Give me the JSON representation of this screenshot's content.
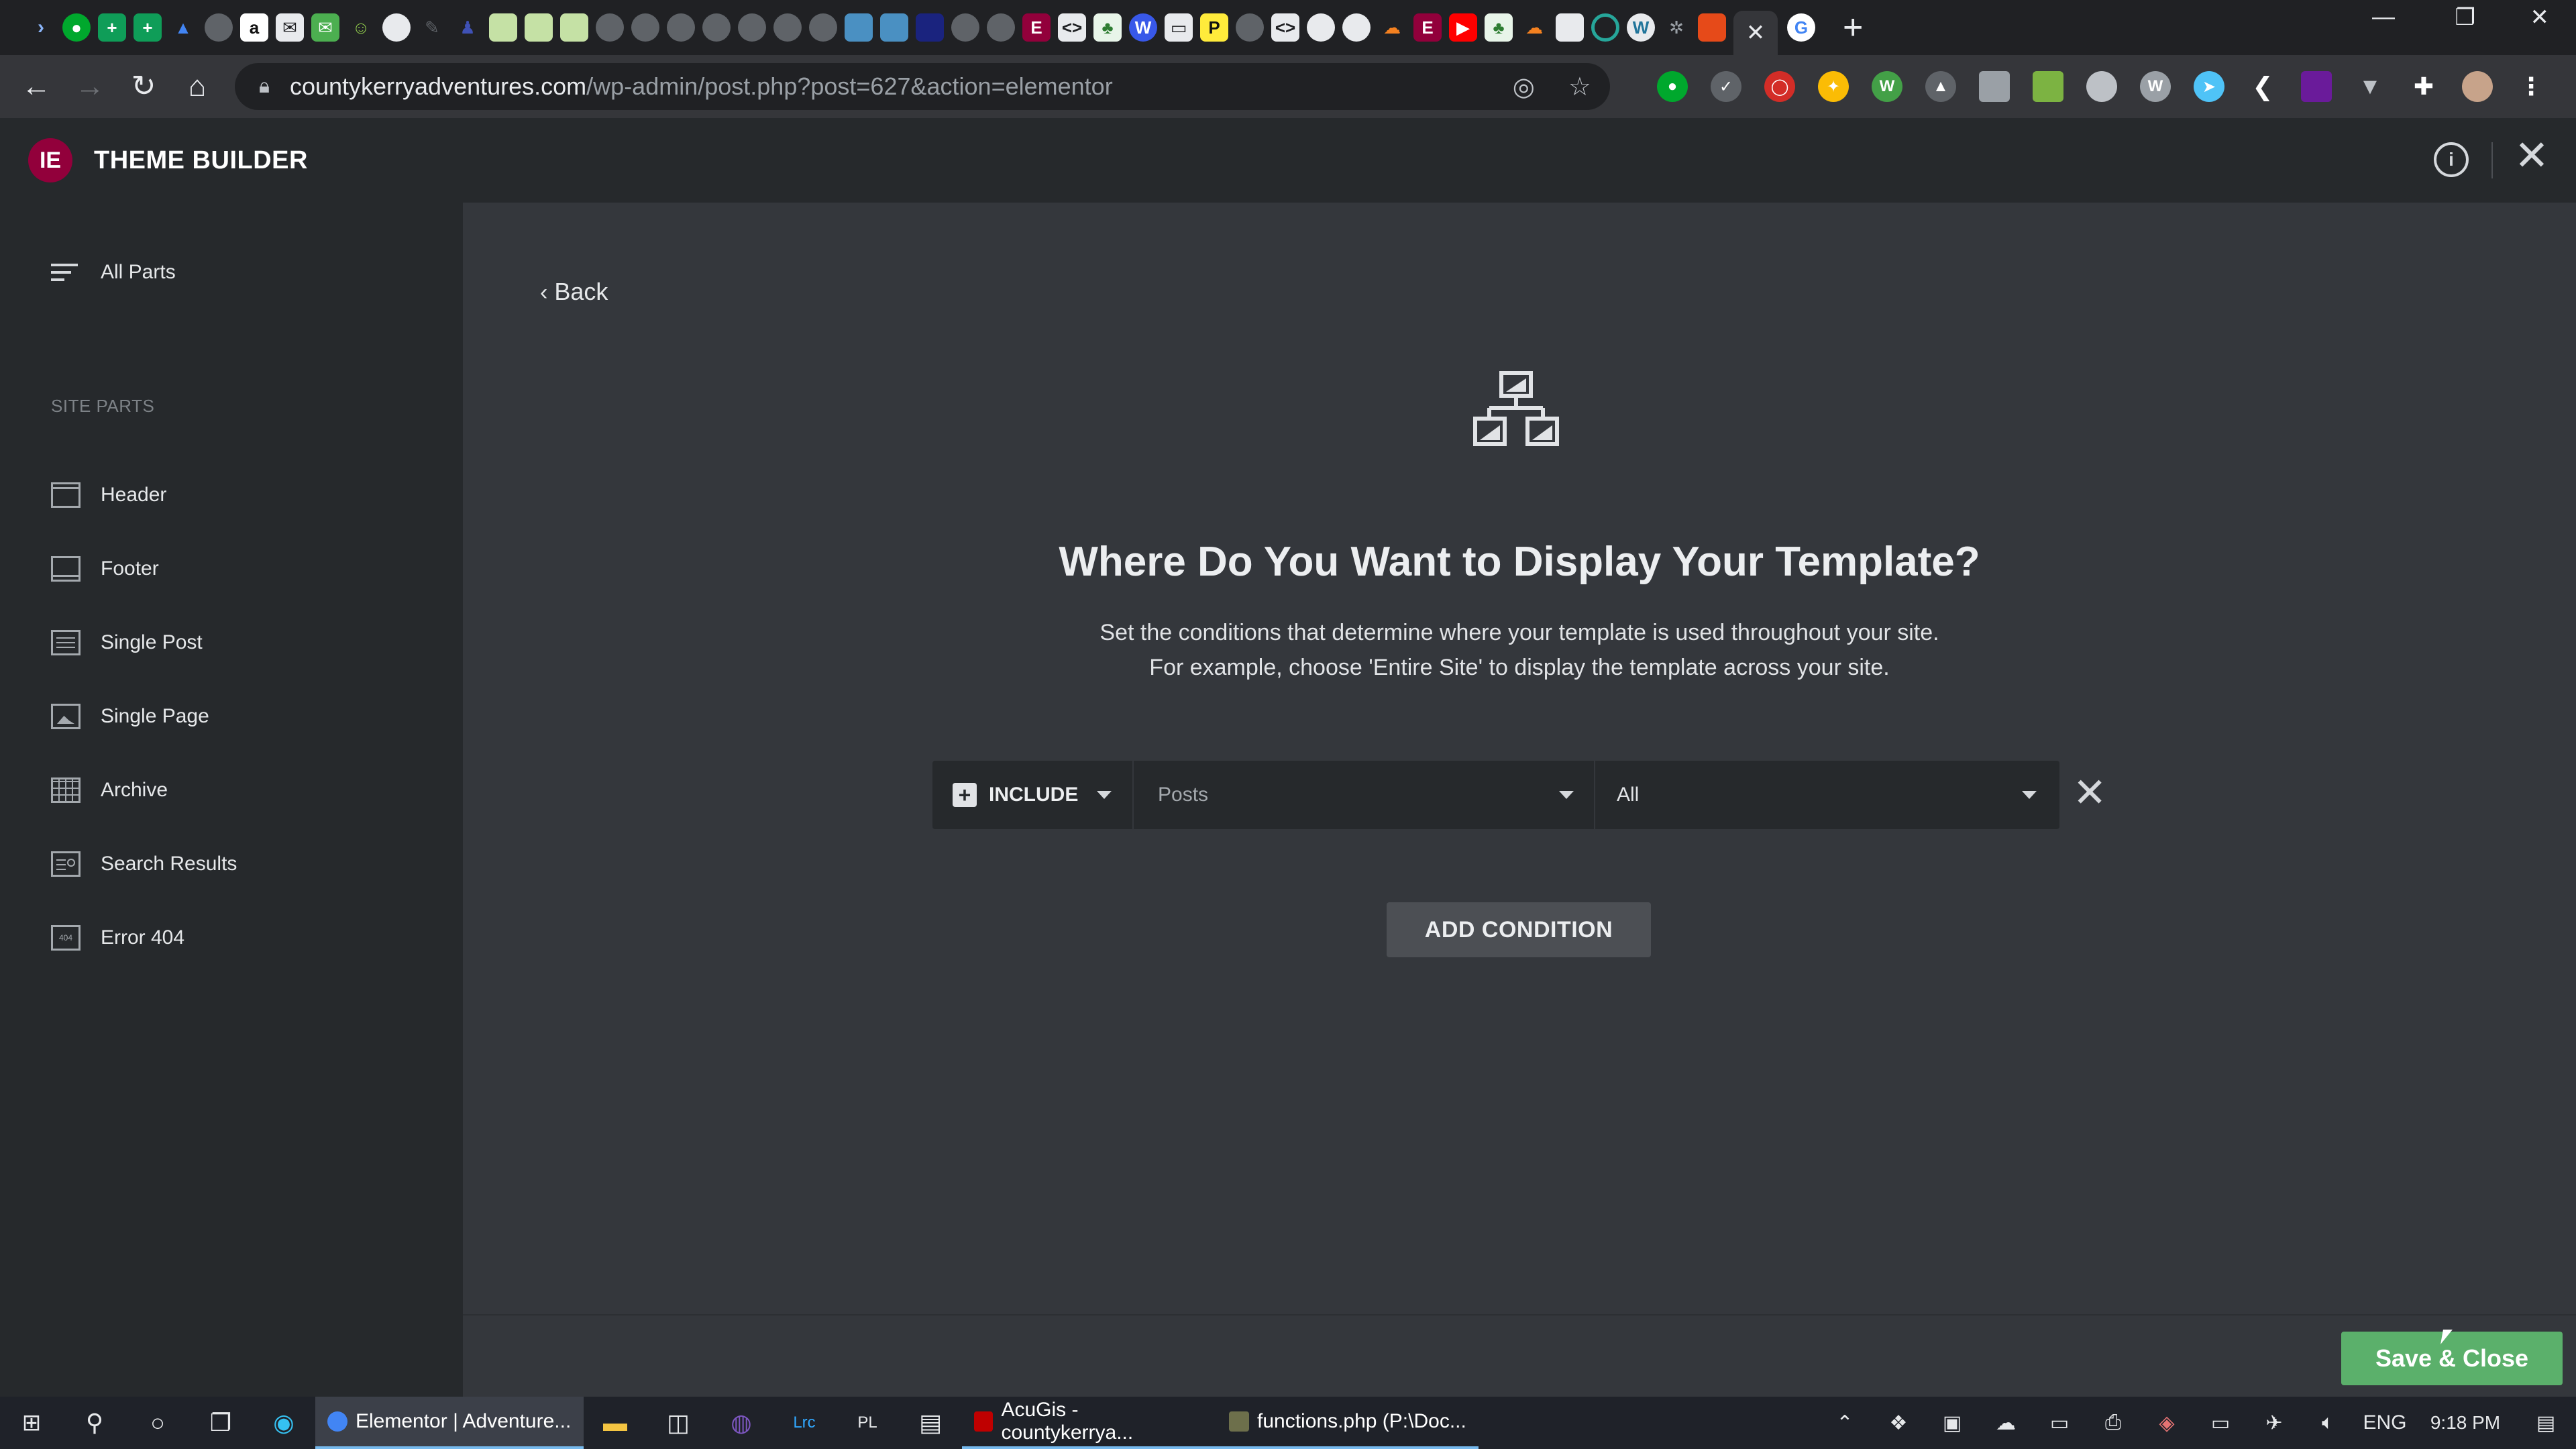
{
  "browser": {
    "tab_close": "✕",
    "new_tab": "+",
    "url_host": "countykerryadventures.com",
    "url_path": "/wp-admin/post.php?post=627&action=elementor",
    "window": {
      "minimize": "—",
      "restore": "❐",
      "close": "✕"
    }
  },
  "header": {
    "logo": "IE",
    "title": "THEME BUILDER",
    "info_icon": "i",
    "close_icon": "✕"
  },
  "sidebar": {
    "all_parts": "All Parts",
    "section_label": "SITE PARTS",
    "items": [
      {
        "label": "Header",
        "icon": "header-icon"
      },
      {
        "label": "Footer",
        "icon": "footer-icon"
      },
      {
        "label": "Single Post",
        "icon": "single-post-icon"
      },
      {
        "label": "Single Page",
        "icon": "single-page-icon"
      },
      {
        "label": "Archive",
        "icon": "archive-icon"
      },
      {
        "label": "Search Results",
        "icon": "search-results-icon"
      },
      {
        "label": "Error 404",
        "icon": "error-404-icon"
      }
    ]
  },
  "main": {
    "back": "Back",
    "title": "Where Do You Want to Display Your Template?",
    "desc_line1": "Set the conditions that determine where your template is used throughout your site.",
    "desc_line2": "For example, choose 'Entire Site' to display the template across your site.",
    "condition": {
      "type": "INCLUDE",
      "location": "Posts",
      "scope": "All",
      "remove": "✕"
    },
    "add_condition": "ADD CONDITION",
    "save_close": "Save & Close"
  },
  "taskbar": {
    "apps": [
      {
        "label": "Elementor | Adventure...",
        "color": "#4285f4"
      },
      {
        "label": "AcuGis - countykerrya...",
        "color": "#bf0000"
      },
      {
        "label": "functions.php (P:\\Doc...",
        "color": "#6d6f4b"
      }
    ],
    "language": "ENG",
    "time": "9:18 PM"
  },
  "colors": {
    "accent": "#92003b",
    "save": "#5bb06b",
    "panel": "#26292c",
    "canvas": "#34373c"
  }
}
